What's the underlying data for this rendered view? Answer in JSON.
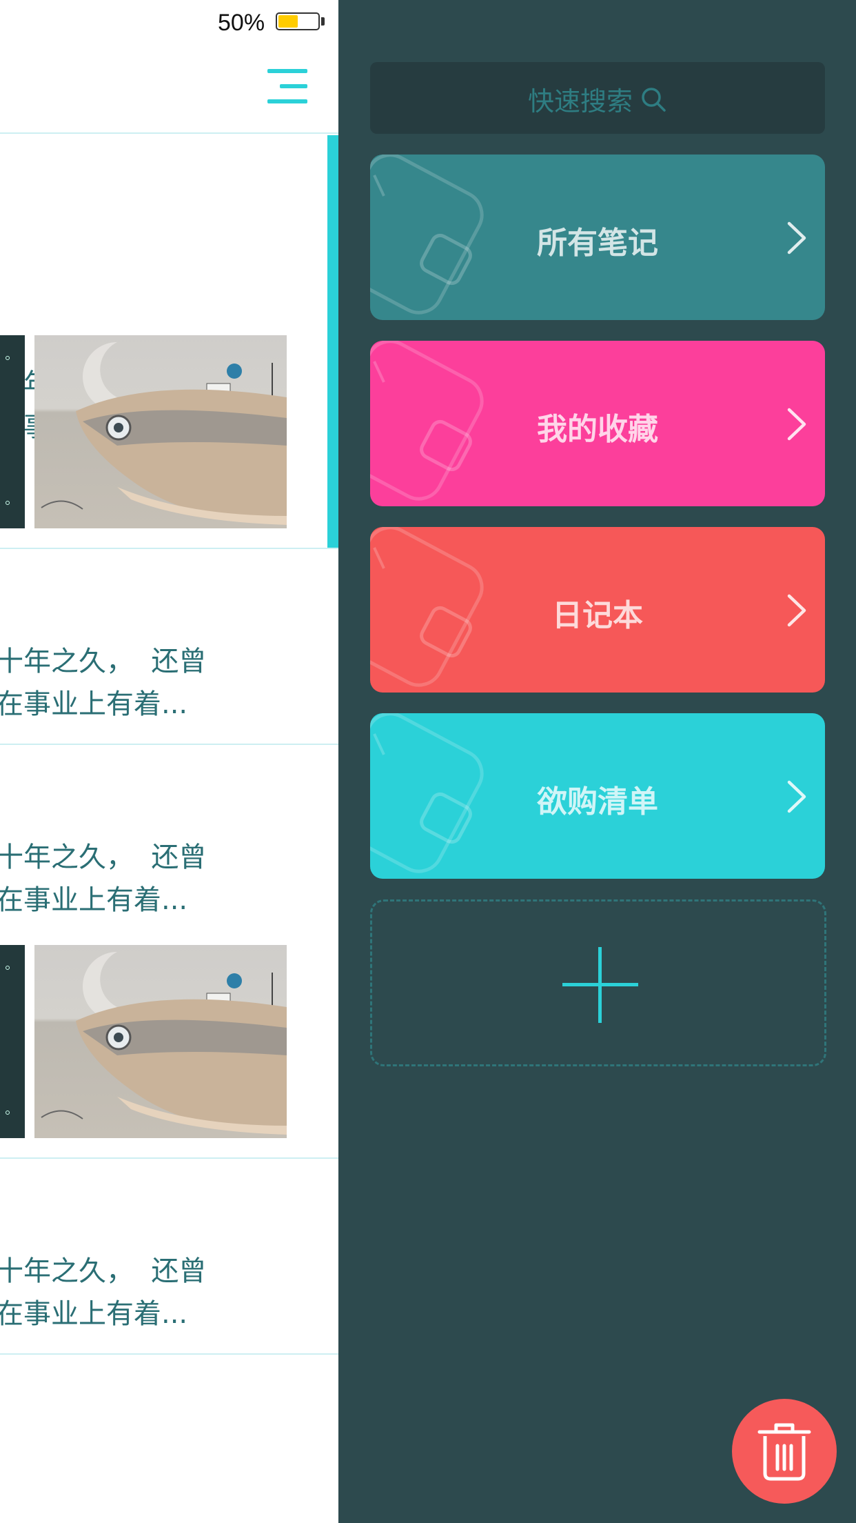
{
  "status_bar": {
    "battery_percent": "50%",
    "battery_level": 0.5,
    "battery_color": "#ffcc00"
  },
  "notes": [
    {
      "line1": "十年之久，  还曾",
      "line2": "在事业上有着...",
      "has_images": true,
      "selected": true
    },
    {
      "line1": "十年之久，  还曾",
      "line2": "在事业上有着...",
      "has_images": false,
      "selected": false
    },
    {
      "line1": "十年之久，  还曾",
      "line2": "在事业上有着...",
      "has_images": true,
      "selected": false
    },
    {
      "line1": "十年之久，  还曾",
      "line2": "在事业上有着...",
      "has_images": false,
      "selected": false
    }
  ],
  "drawer": {
    "search_label": "快速搜索",
    "categories": [
      {
        "label": "所有笔记",
        "color": "#36878c"
      },
      {
        "label": "我的收藏",
        "color": "#fc3f9b"
      },
      {
        "label": "日记本",
        "color": "#f65858"
      },
      {
        "label": "欲购清单",
        "color": "#2bd1d8"
      }
    ],
    "add_icon": "plus-icon",
    "trash_icon": "trash-icon",
    "trash_color": "#f65a5a"
  },
  "colors": {
    "accent": "#2bd1d8",
    "drawer_bg": "#2d4a4e",
    "note_text": "#2a6e74",
    "divider": "#cdeff2"
  }
}
